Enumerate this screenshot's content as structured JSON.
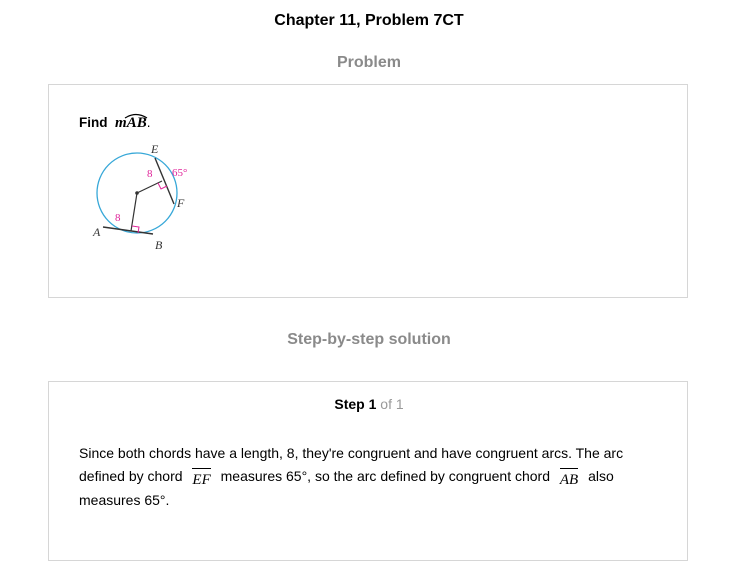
{
  "header": {
    "title": "Chapter 11, Problem 7CT"
  },
  "problem": {
    "heading": "Problem",
    "find_label": "Find",
    "target": "mAB",
    "target_suffix": ".",
    "figure": {
      "labels": {
        "E": "E",
        "F": "F",
        "A": "A",
        "B": "B"
      },
      "chord_length_top": "8",
      "chord_length_bottom": "8",
      "arc_measure": "65°",
      "colors": {
        "circle": "#38a8d8",
        "highlight": "#e0259a",
        "ink": "#333333"
      }
    }
  },
  "solution": {
    "heading": "Step-by-step solution",
    "step_word": "Step",
    "step_number": "1",
    "step_total": "of 1",
    "text_part1": "Since both chords have a length, 8, they're congruent and have congruent arcs. The arc defined by chord",
    "chord1": "EF",
    "text_part2": "measures 65°, so the arc defined by congruent chord",
    "chord2": "AB",
    "text_part3": "also measures 65°."
  }
}
